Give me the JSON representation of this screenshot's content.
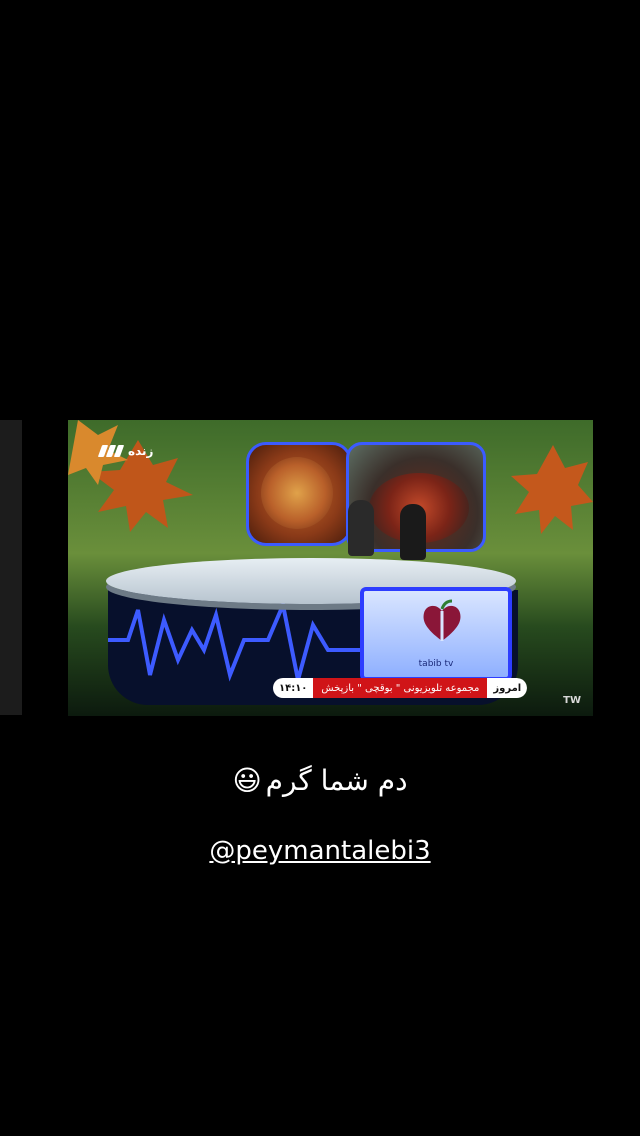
{
  "tv": {
    "live_label": "زنده",
    "brand_text": "tabib tv",
    "ticker": {
      "time": "۱۴:۱۰",
      "message": "مجموعه تلویزیونی \" بوقچی \" بازپخش",
      "tag": "امروز"
    },
    "channel_mark": "TW"
  },
  "caption": {
    "text": "دم شما گرم",
    "emoji": "😃"
  },
  "handle": "@peymantalebi3",
  "colors": {
    "background": "#000000",
    "ticker_red": "#d01418",
    "accent_blue": "#2d3dff"
  }
}
